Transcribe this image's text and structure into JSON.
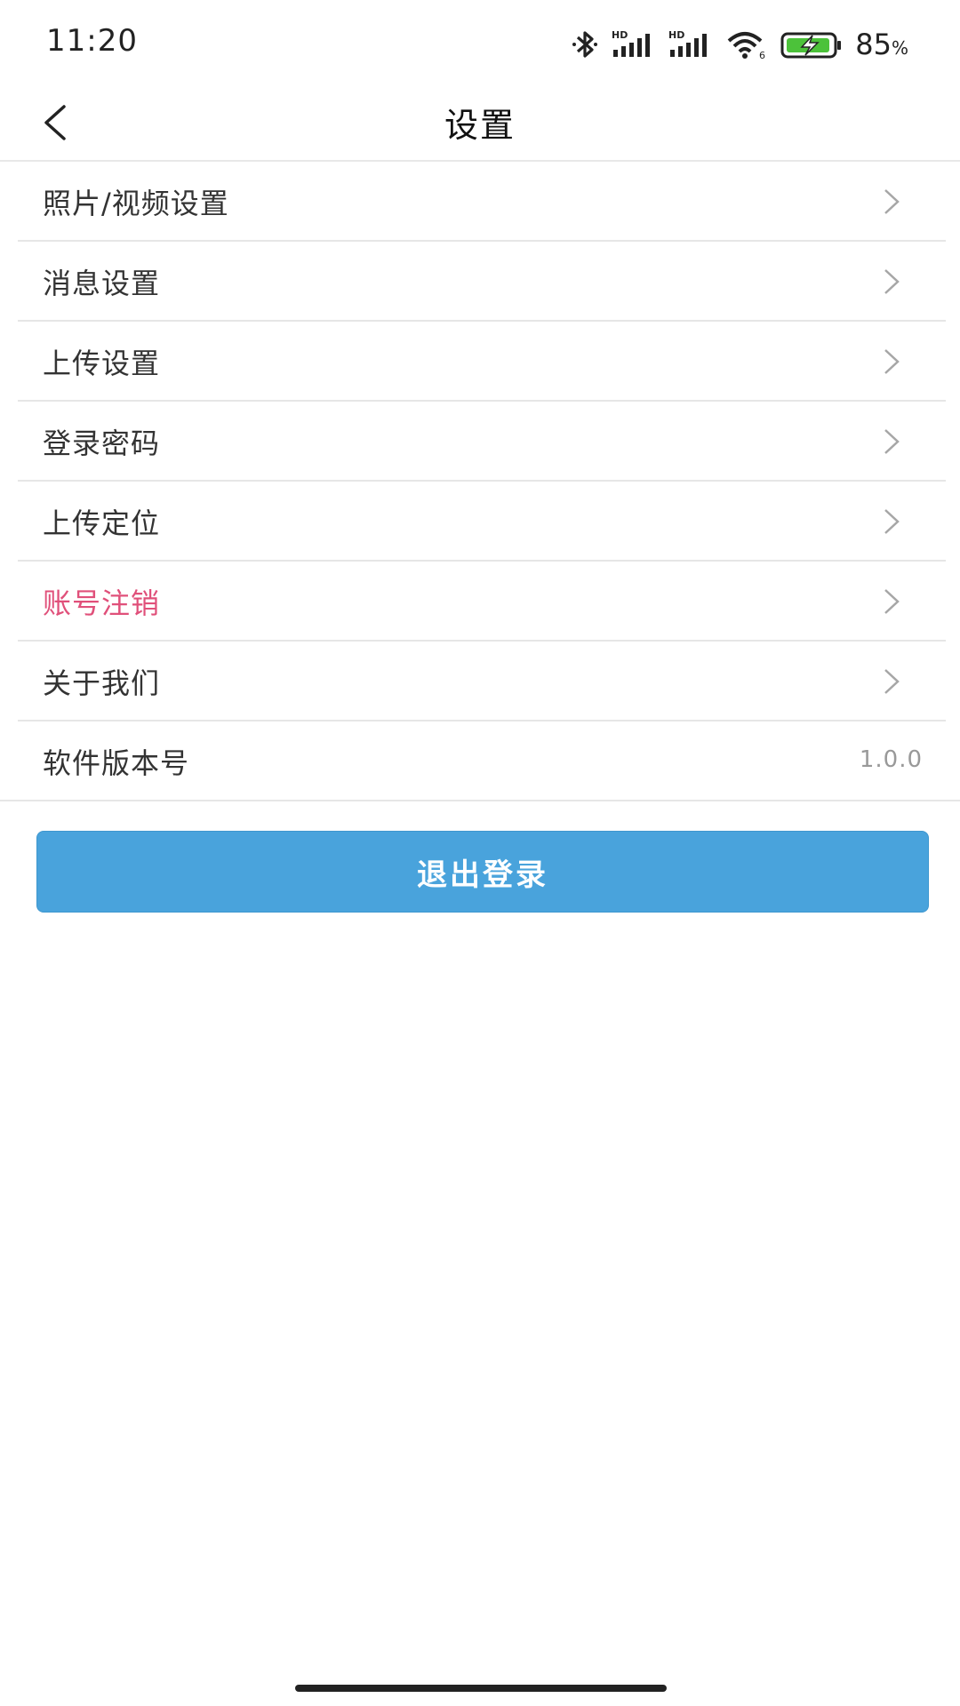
{
  "status_bar": {
    "time": "11:20",
    "battery_percent": "85",
    "battery_unit": "%",
    "icons": [
      "bluetooth-icon",
      "hd-signal-icon",
      "hd-signal-icon",
      "wifi-icon",
      "battery-charging-icon"
    ],
    "battery_color": "#4cc23a"
  },
  "header": {
    "title": "设置",
    "back_icon": "chevron-left-icon"
  },
  "settings": {
    "items": [
      {
        "label": "照片/视频设置"
      },
      {
        "label": "消息设置"
      },
      {
        "label": "上传设置"
      },
      {
        "label": "登录密码"
      },
      {
        "label": "上传定位"
      },
      {
        "label": "账号注销",
        "color": "#e0507a"
      },
      {
        "label": "关于我们"
      }
    ],
    "version": {
      "label": "软件版本号",
      "value": "1.0.0"
    }
  },
  "logout": {
    "label": "退出登录",
    "color": "#49a3dc"
  }
}
